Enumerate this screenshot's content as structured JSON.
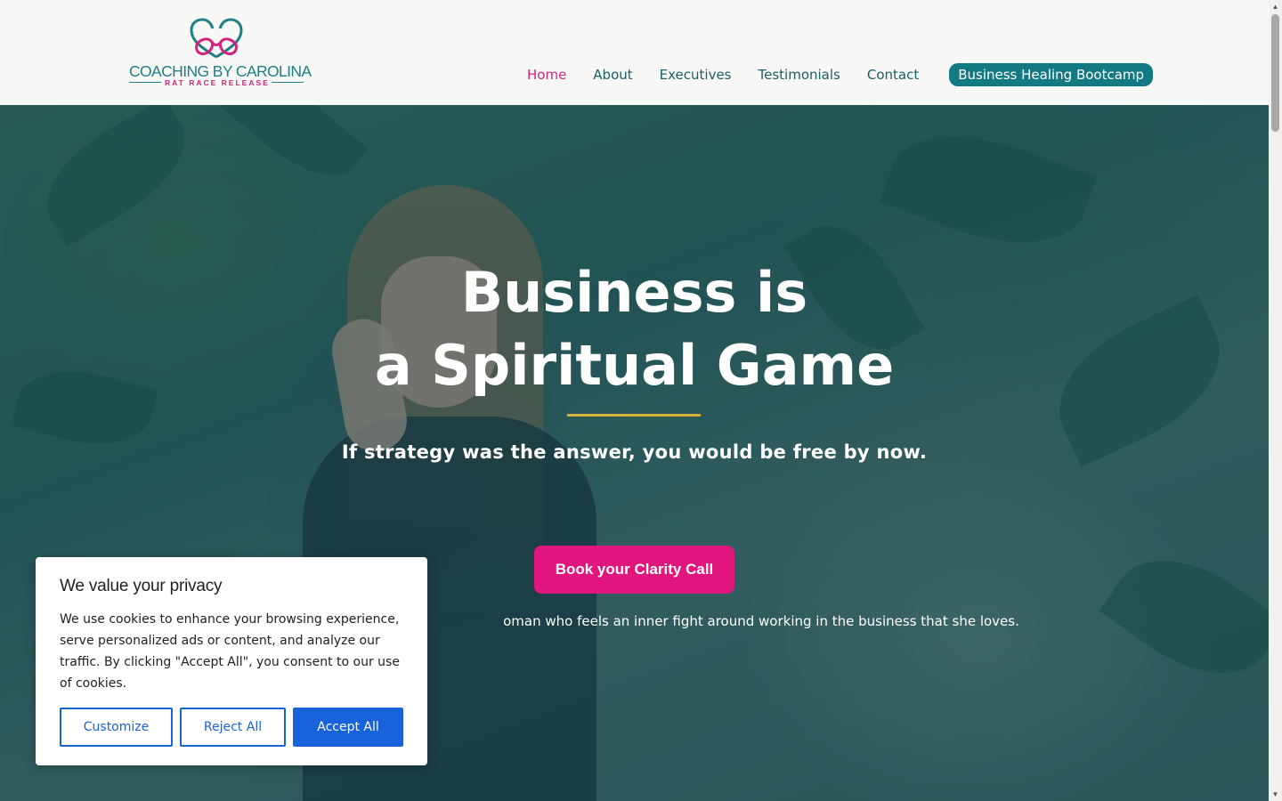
{
  "brand": {
    "name": "COACHING BY CAROLINA",
    "tagline": "RAT RACE RELEASE",
    "primary_color": "#137a83",
    "accent_color": "#d3237a",
    "logo_icon": "double-heart-logo-icon"
  },
  "nav": {
    "items": [
      {
        "label": "Home",
        "active": true
      },
      {
        "label": "About"
      },
      {
        "label": "Executives"
      },
      {
        "label": "Testimonials"
      },
      {
        "label": "Contact"
      }
    ],
    "cta_label": "Business Healing Bootcamp"
  },
  "hero": {
    "title": "Business is\na Spiritual Game",
    "subtitle": "If strategy was the answer, you would be free by now.",
    "button_label": "Book your Clarity Call",
    "button_color": "#e0157d",
    "rule_color": "#d6b23a",
    "description_visible": "oman who feels an inner fight around working in the business that she loves."
  },
  "cookie_banner": {
    "title": "We value your privacy",
    "body": "We use cookies to enhance your browsing experience, serve personalized ads or content, and analyze our traffic. By clicking \"Accept All\", you consent to our use of cookies.",
    "customize_label": "Customize",
    "reject_label": "Reject All",
    "accept_label": "Accept All",
    "button_color": "#1863dc"
  }
}
